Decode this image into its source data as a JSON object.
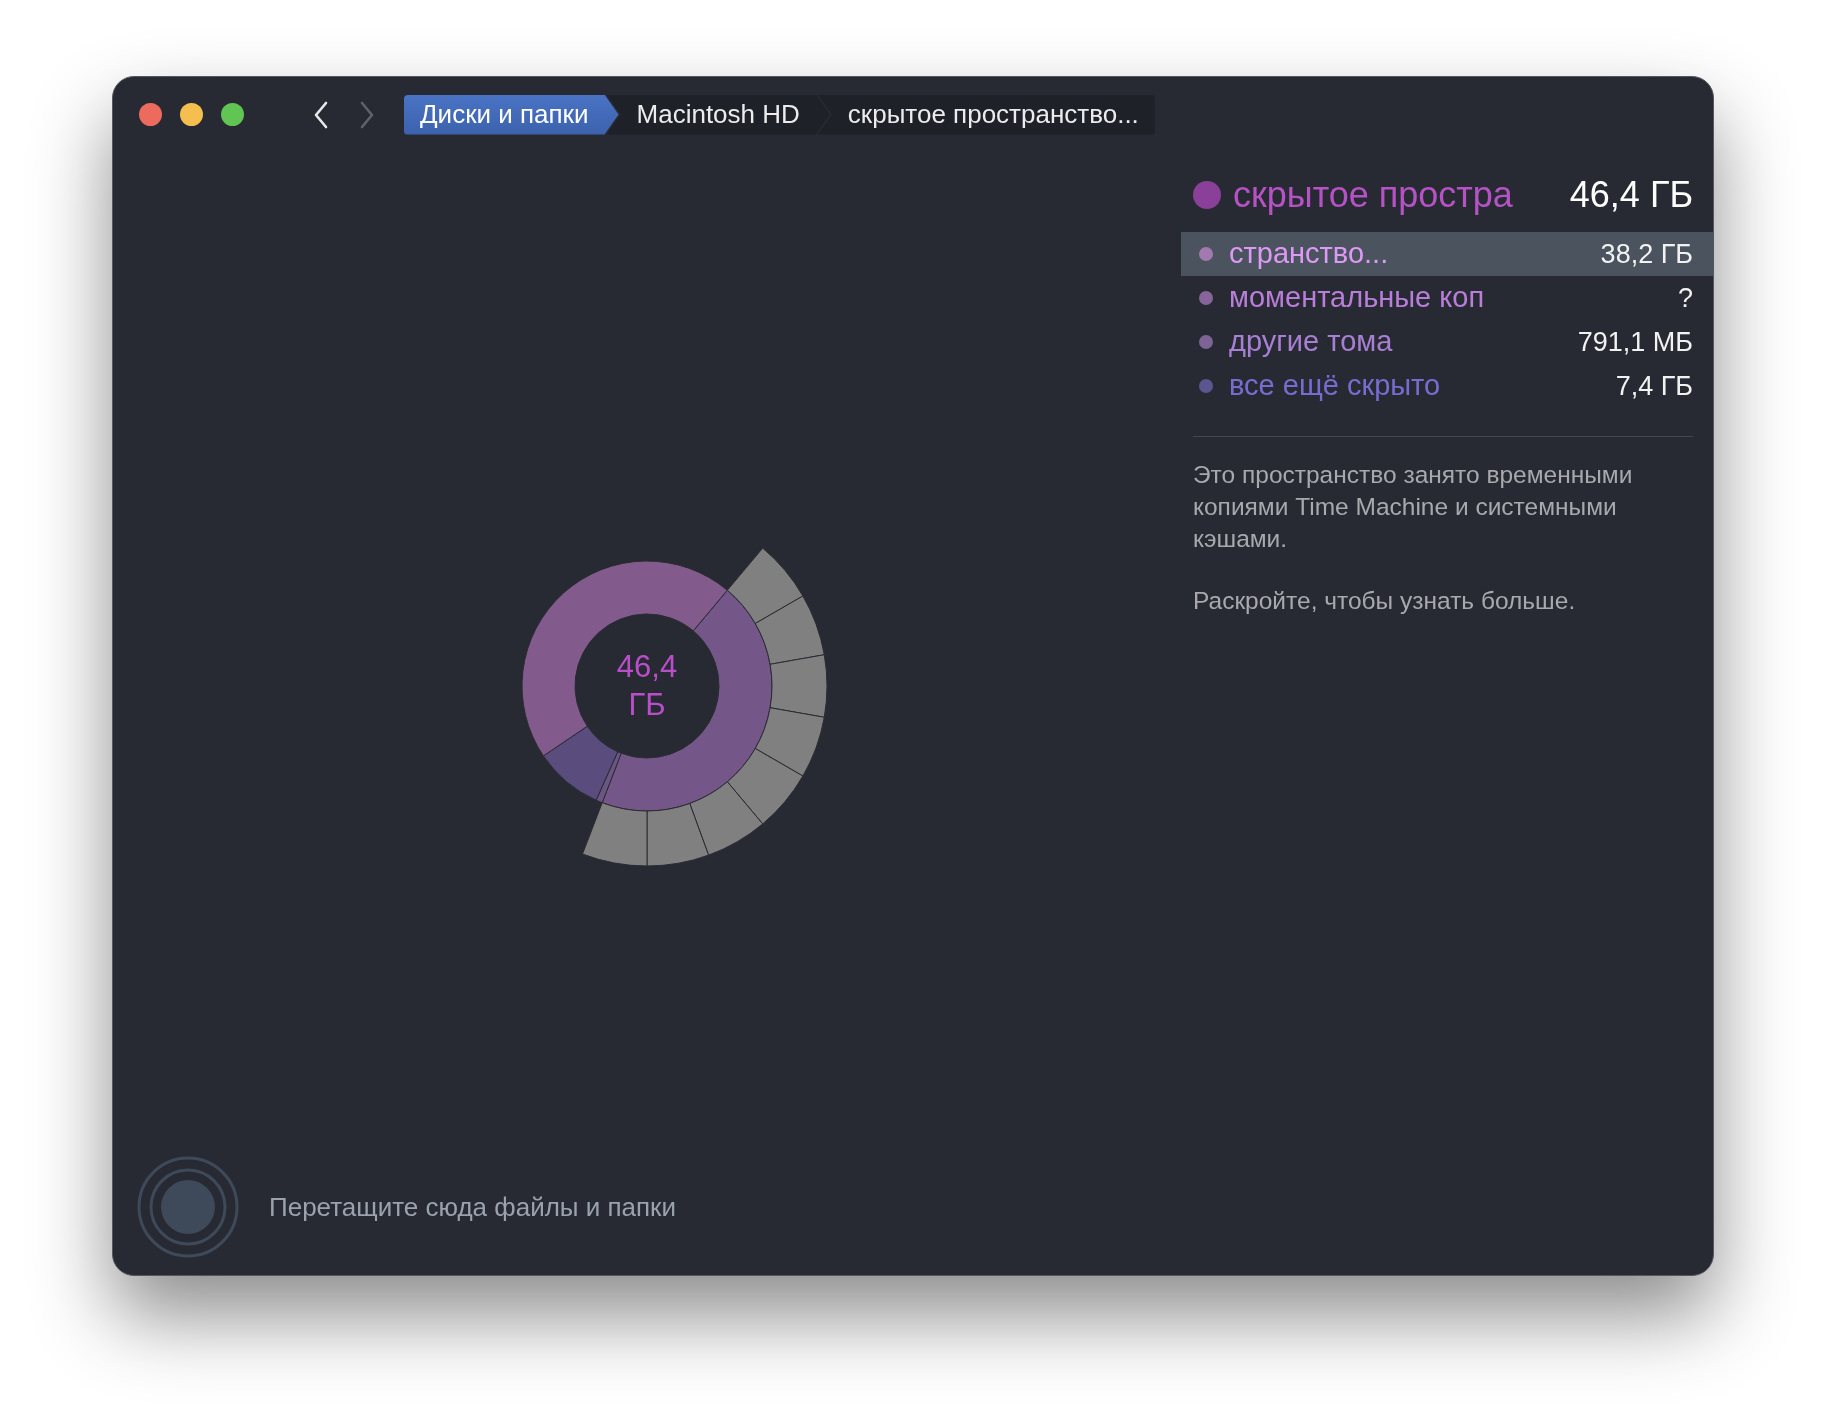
{
  "navigation": {
    "back": {
      "disabled": false
    },
    "forward": {
      "disabled": true
    }
  },
  "breadcrumbs": [
    {
      "label": "Диски и папки",
      "selected": true
    },
    {
      "label": "Macintosh HD",
      "selected": false
    },
    {
      "label": "скрытое пространство...",
      "selected": false
    }
  ],
  "chart": {
    "center_value": "46,4",
    "center_unit": "ГБ"
  },
  "summary": {
    "name": "скрытое простра",
    "size": "46,4 ГБ",
    "color": "#8a3f98"
  },
  "items": [
    {
      "name": "странство...",
      "size": "38,2 ГБ",
      "color": "#a27ab0",
      "selected": true
    },
    {
      "name": "моментальные коп",
      "size": "?",
      "color": "#87649a",
      "selected": false
    },
    {
      "name": "другие тома",
      "size": "791,1 МБ",
      "color": "#7c6496",
      "selected": false
    },
    {
      "name": "все ещё скрыто",
      "size": "7,4 ГБ",
      "color": "#5c5590",
      "selected": false
    }
  ],
  "description": [
    "Это пространство занято временными копиями Time Machine и системными кэшами.",
    "Раскройте, чтобы узнать больше."
  ],
  "drop_zone": {
    "label": "Перетащите сюда файлы и папки"
  }
}
